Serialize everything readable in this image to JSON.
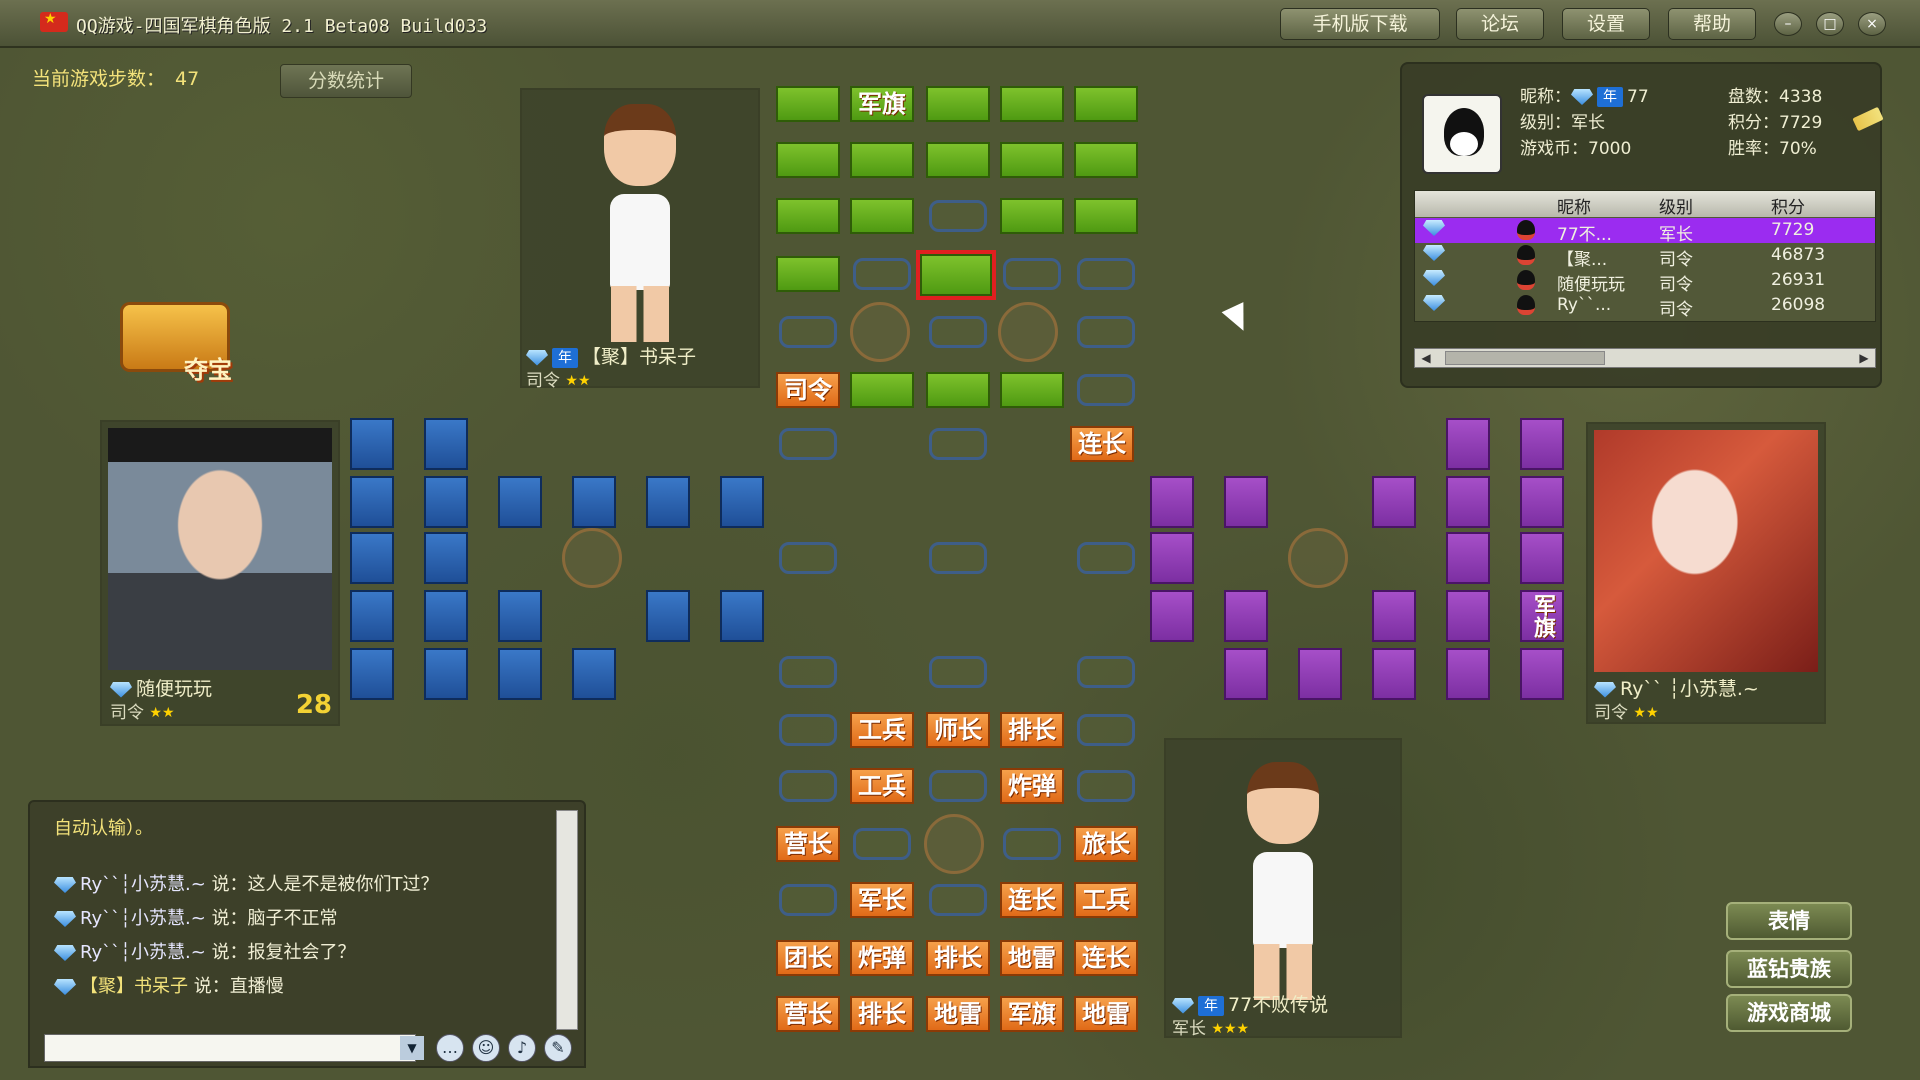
{
  "window": {
    "title": "QQ游戏-四国军棋角色版 2.1 Beta08 Build033",
    "buttons": [
      "手机版下载",
      "论坛",
      "设置",
      "帮助"
    ],
    "controls": [
      "–",
      "□",
      "×"
    ]
  },
  "status": {
    "steps_label": "当前游戏步数：",
    "steps_value": "47",
    "score_button": "分数统计"
  },
  "treasure": {
    "label": "夺宝"
  },
  "players": {
    "top": {
      "name": "【聚】书呆子",
      "rank": "司令",
      "year": "年"
    },
    "left": {
      "name": "随便玩玩",
      "rank": "司令",
      "count": "28"
    },
    "right": {
      "name": "Ry`` ┆小苏慧.~",
      "rank": "司令"
    },
    "bottom": {
      "name": "77不败传说",
      "rank": "军长",
      "year": "年"
    }
  },
  "info_panel": {
    "nick_label": "昵称：",
    "nick_value": "77",
    "year": "年",
    "level_label": "级别：",
    "level_value": "军长",
    "coins_label": "游戏币：",
    "coins_value": "7000",
    "games_label": "盘数：",
    "games_value": "4338",
    "points_label": "积分：",
    "points_value": "7729",
    "winrate_label": "胜率：",
    "winrate_value": "70%",
    "table_headers": [
      "昵称",
      "级别",
      "积分"
    ],
    "rows": [
      {
        "nick": "77不...",
        "level": "军长",
        "points": "7729"
      },
      {
        "nick": "【聚...",
        "level": "司令",
        "points": "46873"
      },
      {
        "nick": "随便玩玩",
        "level": "司令",
        "points": "26931"
      },
      {
        "nick": "Ry``...",
        "level": "司令",
        "points": "26098"
      }
    ]
  },
  "board_labels": {
    "green_flag": "军旗",
    "top_commander": "司令",
    "company_cmdr": "连长",
    "purple_flag": "军旗",
    "bottom": [
      [
        "工兵",
        "师长",
        "排长"
      ],
      [
        "工兵",
        "炸弹"
      ],
      [
        "营长",
        "旅长"
      ],
      [
        "军长",
        "连长",
        "工兵"
      ],
      [
        "团长",
        "炸弹",
        "排长",
        "地雷",
        "连长"
      ],
      [
        "营长",
        "排长",
        "地雷",
        "军旗",
        "地雷"
      ]
    ]
  },
  "chat": {
    "top_line": "自动认输）。",
    "messages": [
      {
        "who": "Ry``┆小苏慧.~",
        "text": "说：这人是不是被你们T过？"
      },
      {
        "who": "Ry``┆小苏慧.~",
        "text": "说：脑子不正常"
      },
      {
        "who": "Ry``┆小苏慧.~",
        "text": "说：报复社会了？"
      },
      {
        "who": "【聚】书呆子",
        "text": "说：直播慢"
      }
    ],
    "input_value": ""
  },
  "side_buttons": [
    "表情",
    "蓝钻贵族",
    "游戏商城"
  ],
  "colors": {
    "green": "#62ad1c",
    "blue": "#2a62b0",
    "purple": "#8f3cb4",
    "orange": "#ee8430"
  }
}
